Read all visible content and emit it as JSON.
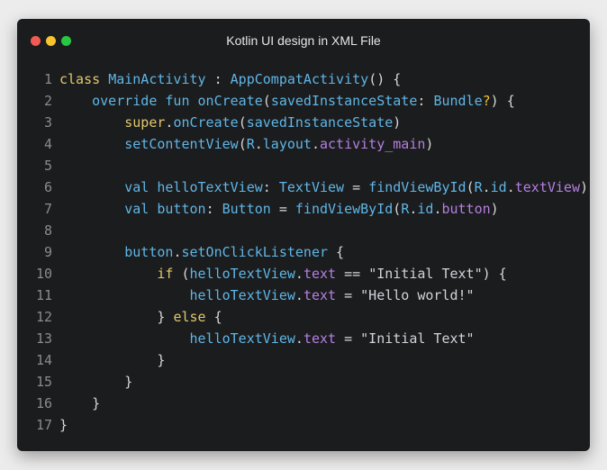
{
  "window": {
    "title": "Kotlin UI design in XML File",
    "controls": [
      "close",
      "minimize",
      "maximize"
    ]
  },
  "code": {
    "language": "Kotlin",
    "lines": [
      {
        "n": "1",
        "tokens": [
          [
            "kw",
            "class"
          ],
          [
            "plain",
            " "
          ],
          [
            "cls",
            "MainActivity"
          ],
          [
            "plain",
            " : "
          ],
          [
            "cls",
            "AppCompatActivity"
          ],
          [
            "plain",
            "() {"
          ]
        ]
      },
      {
        "n": "2",
        "tokens": [
          [
            "plain",
            "    "
          ],
          [
            "kw2",
            "override"
          ],
          [
            "plain",
            " "
          ],
          [
            "kw2",
            "fun"
          ],
          [
            "plain",
            " "
          ],
          [
            "fn",
            "onCreate"
          ],
          [
            "plain",
            "("
          ],
          [
            "id",
            "savedInstanceState"
          ],
          [
            "plain",
            ": "
          ],
          [
            "cls",
            "Bundle"
          ],
          [
            "op",
            "?"
          ],
          [
            "plain",
            ") {"
          ]
        ]
      },
      {
        "n": "3",
        "tokens": [
          [
            "plain",
            "        "
          ],
          [
            "kw",
            "super"
          ],
          [
            "plain",
            "."
          ],
          [
            "fn",
            "onCreate"
          ],
          [
            "plain",
            "("
          ],
          [
            "id",
            "savedInstanceState"
          ],
          [
            "plain",
            ")"
          ]
        ]
      },
      {
        "n": "4",
        "tokens": [
          [
            "plain",
            "        "
          ],
          [
            "fn",
            "setContentView"
          ],
          [
            "plain",
            "("
          ],
          [
            "id",
            "R"
          ],
          [
            "plain",
            "."
          ],
          [
            "id",
            "layout"
          ],
          [
            "plain",
            "."
          ],
          [
            "prop",
            "activity_main"
          ],
          [
            "plain",
            ")"
          ]
        ]
      },
      {
        "n": "5",
        "tokens": []
      },
      {
        "n": "6",
        "tokens": [
          [
            "plain",
            "        "
          ],
          [
            "kw2",
            "val"
          ],
          [
            "plain",
            " "
          ],
          [
            "id",
            "helloTextView"
          ],
          [
            "plain",
            ": "
          ],
          [
            "cls",
            "TextView"
          ],
          [
            "plain",
            " = "
          ],
          [
            "fn",
            "findViewById"
          ],
          [
            "plain",
            "("
          ],
          [
            "id",
            "R"
          ],
          [
            "plain",
            "."
          ],
          [
            "id",
            "id"
          ],
          [
            "plain",
            "."
          ],
          [
            "prop",
            "textView"
          ],
          [
            "plain",
            ")"
          ]
        ]
      },
      {
        "n": "7",
        "tokens": [
          [
            "plain",
            "        "
          ],
          [
            "kw2",
            "val"
          ],
          [
            "plain",
            " "
          ],
          [
            "id",
            "button"
          ],
          [
            "plain",
            ": "
          ],
          [
            "cls",
            "Button"
          ],
          [
            "plain",
            " = "
          ],
          [
            "fn",
            "findViewById"
          ],
          [
            "plain",
            "("
          ],
          [
            "id",
            "R"
          ],
          [
            "plain",
            "."
          ],
          [
            "id",
            "id"
          ],
          [
            "plain",
            "."
          ],
          [
            "prop",
            "button"
          ],
          [
            "plain",
            ")"
          ]
        ]
      },
      {
        "n": "8",
        "tokens": []
      },
      {
        "n": "9",
        "tokens": [
          [
            "plain",
            "        "
          ],
          [
            "id",
            "button"
          ],
          [
            "plain",
            "."
          ],
          [
            "fn",
            "setOnClickListener"
          ],
          [
            "plain",
            " {"
          ]
        ]
      },
      {
        "n": "10",
        "tokens": [
          [
            "plain",
            "            "
          ],
          [
            "kw",
            "if"
          ],
          [
            "plain",
            " ("
          ],
          [
            "id",
            "helloTextView"
          ],
          [
            "plain",
            "."
          ],
          [
            "prop",
            "text"
          ],
          [
            "plain",
            " == "
          ],
          [
            "str",
            "\"Initial Text\""
          ],
          [
            "plain",
            ") {"
          ]
        ]
      },
      {
        "n": "11",
        "tokens": [
          [
            "plain",
            "                "
          ],
          [
            "id",
            "helloTextView"
          ],
          [
            "plain",
            "."
          ],
          [
            "prop",
            "text"
          ],
          [
            "plain",
            " = "
          ],
          [
            "str",
            "\"Hello world!\""
          ]
        ]
      },
      {
        "n": "12",
        "tokens": [
          [
            "plain",
            "            } "
          ],
          [
            "kw",
            "else"
          ],
          [
            "plain",
            " {"
          ]
        ]
      },
      {
        "n": "13",
        "tokens": [
          [
            "plain",
            "                "
          ],
          [
            "id",
            "helloTextView"
          ],
          [
            "plain",
            "."
          ],
          [
            "prop",
            "text"
          ],
          [
            "plain",
            " = "
          ],
          [
            "str",
            "\"Initial Text\""
          ]
        ]
      },
      {
        "n": "14",
        "tokens": [
          [
            "plain",
            "            }"
          ]
        ]
      },
      {
        "n": "15",
        "tokens": [
          [
            "plain",
            "        }"
          ]
        ]
      },
      {
        "n": "16",
        "tokens": [
          [
            "plain",
            "    }"
          ]
        ]
      },
      {
        "n": "17",
        "tokens": [
          [
            "plain",
            "}"
          ]
        ]
      }
    ]
  }
}
